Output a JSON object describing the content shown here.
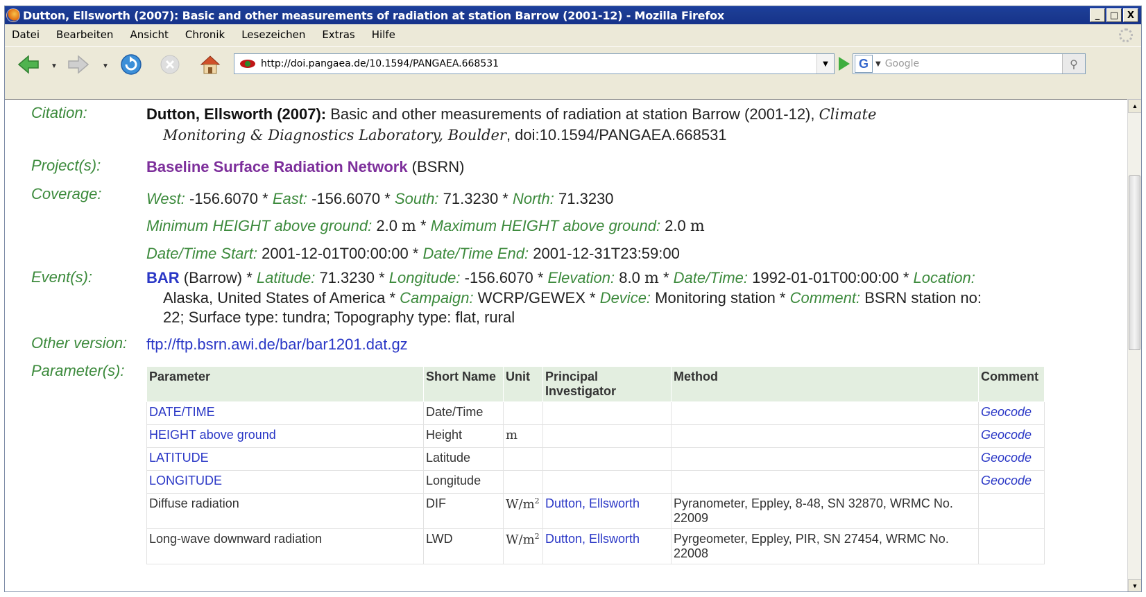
{
  "window": {
    "title": "Dutton, Ellsworth (2007): Basic and other measurements of radiation at station Barrow (2001-12) - Mozilla Firefox",
    "controls": [
      "_",
      "□",
      "X"
    ]
  },
  "menu": [
    "Datei",
    "Bearbeiten",
    "Ansicht",
    "Chronik",
    "Lesezeichen",
    "Extras",
    "Hilfe"
  ],
  "toolbar": {
    "url": "http://doi.pangaea.de/10.1594/PANGAEA.668531",
    "search_placeholder": "Google",
    "search_engine": "G"
  },
  "page": {
    "citation": {
      "label": "Citation:",
      "author": "Dutton, Ellsworth (2007):",
      "title": " Basic and other measurements of radiation at station Barrow (2001-12), ",
      "source_a": "Climate",
      "source_b": "Monitoring & Diagnostics Laboratory, Boulder",
      "doi": ", doi:10.1594/PANGAEA.668531"
    },
    "project": {
      "label": "Project(s):",
      "name": "Baseline Surface Radiation Network",
      "abbr": " (BSRN)"
    },
    "coverage": {
      "label": "Coverage:",
      "west_k": "West:",
      "west_v": " -156.6070 * ",
      "east_k": "East:",
      "east_v": " -156.6070 * ",
      "south_k": "South:",
      "south_v": " 71.3230 * ",
      "north_k": "North:",
      "north_v": " 71.3230",
      "minh_k": "Minimum HEIGHT above ground:",
      "minh_v": " 2.0 ",
      "minh_u": "m",
      "sep": " * ",
      "maxh_k": "Maximum HEIGHT above ground:",
      "maxh_v": " 2.0 ",
      "maxh_u": "m",
      "start_k": "Date/Time Start:",
      "start_v": " 2001-12-01T00:00:00 * ",
      "end_k": "Date/Time End:",
      "end_v": " 2001-12-31T23:59:00"
    },
    "event": {
      "label": "Event(s):",
      "code": "BAR",
      "name": " (Barrow) * ",
      "lat_k": "Latitude:",
      "lat_v": " 71.3230 * ",
      "lon_k": "Longitude:",
      "lon_v": " -156.6070 * ",
      "elev_k": "Elevation:",
      "elev_v": " 8.0 ",
      "elev_u": "m",
      "sep": " * ",
      "dt_k": "Date/Time:",
      "dt_v": " 1992-01-01T00:00:00 * ",
      "loc_k": "Location:",
      "loc_v": "Alaska, United States of America * ",
      "camp_k": "Campaign:",
      "camp_v": " WCRP/GEWEX * ",
      "dev_k": "Device:",
      "dev_v": " Monitoring station * ",
      "com_k": "Comment:",
      "com_v": " BSRN station no:",
      "com_v2": "22; Surface type: tundra; Topography type: flat, rural"
    },
    "other_version": {
      "label": "Other version:",
      "link": "ftp://ftp.bsrn.awi.de/bar/bar1201.dat.gz"
    },
    "parameters": {
      "label": "Parameter(s):",
      "headers": {
        "parameter": "Parameter",
        "short": "Short Name",
        "unit": "Unit",
        "pi_a": "Principal",
        "pi_b": "Investigator",
        "method": "Method",
        "comment": "Comment"
      },
      "rows": [
        {
          "parameter": "DATE/TIME",
          "short": "Date/Time",
          "unit": "",
          "pi": "",
          "method_a": "",
          "method_b": "",
          "comment": "Geocode"
        },
        {
          "parameter": "HEIGHT above ground",
          "short": "Height",
          "unit": "m",
          "pi": "",
          "method_a": "",
          "method_b": "",
          "comment": "Geocode"
        },
        {
          "parameter": "LATITUDE",
          "short": "Latitude",
          "unit": "",
          "pi": "",
          "method_a": "",
          "method_b": "",
          "comment": "Geocode"
        },
        {
          "parameter": "LONGITUDE",
          "short": "Longitude",
          "unit": "",
          "pi": "",
          "method_a": "",
          "method_b": "",
          "comment": "Geocode"
        },
        {
          "parameter": "Diffuse radiation",
          "short": "DIF",
          "unit": "W/m",
          "unit_sup": "2",
          "pi": "Dutton, Ellsworth",
          "method_a": "Pyranometer, Eppley, 8-48, SN 32870, WRMC No.",
          "method_b": "22009",
          "comment": ""
        },
        {
          "parameter": "Long-wave downward radiation",
          "short": "LWD",
          "unit": "W/m",
          "unit_sup": "2",
          "pi": "Dutton, Ellsworth",
          "method_a": "Pyrgeometer, Eppley, PIR, SN 27454, WRMC No.",
          "method_b": "22008",
          "comment": ""
        }
      ]
    }
  }
}
